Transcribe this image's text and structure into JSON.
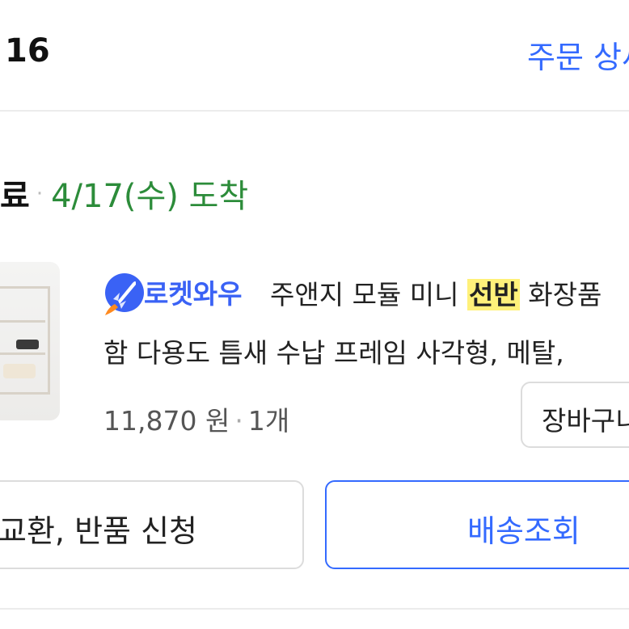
{
  "header": {
    "order_date": "16",
    "order_detail_link": "주문 상세"
  },
  "shipment": {
    "status": "료",
    "separator": "·",
    "arrival": "4/17(수) 도착"
  },
  "product": {
    "badge_icon": "rocket-icon",
    "badge_label": "로켓와우",
    "title_line1_before": "주앤지 모듈 미니",
    "title_highlight": "선반",
    "title_line1_after": "화장품",
    "title_line2": "함 다용도 틈새 수납 프레임 사각형, 메탈,",
    "price": "11,870 원",
    "price_separator": "·",
    "quantity": "1개",
    "cart_button": "장바구니"
  },
  "actions": {
    "return_button": "교환, 반품 신청",
    "track_button": "배송조회"
  },
  "colors": {
    "accent_blue": "#346aff",
    "arrival_green": "#2c8c3a",
    "highlight_yellow": "#fff17a",
    "border_gray": "#dcdcdc"
  }
}
